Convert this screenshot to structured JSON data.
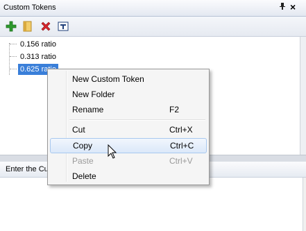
{
  "panel": {
    "title": "Custom Tokens",
    "pin_icon": "pin-icon",
    "close_icon": "close-icon"
  },
  "toolbar": {
    "buttons": [
      {
        "name": "add-button",
        "icon": "green-plus-icon",
        "color": "#2e9a2e"
      },
      {
        "name": "folder-button",
        "icon": "folder-icon",
        "color": "#e0b64a"
      },
      {
        "name": "delete-button",
        "icon": "red-x-icon",
        "color": "#d6262c"
      },
      {
        "name": "text-button",
        "icon": "text-icon",
        "color": "#1f3f7a"
      }
    ]
  },
  "tree": {
    "items": [
      {
        "label": "0.156 ratio",
        "selected": false
      },
      {
        "label": "0.313 ratio",
        "selected": false
      },
      {
        "label": "0.625 ratio",
        "selected": true
      }
    ]
  },
  "bottom_panel": {
    "header": "Enter the Cu"
  },
  "context_menu": {
    "items": [
      {
        "label": "New Custom Token",
        "shortcut": ""
      },
      {
        "label": "New Folder",
        "shortcut": ""
      },
      {
        "label": "Rename",
        "shortcut": "F2"
      },
      {
        "label": "Cut",
        "shortcut": "Ctrl+X"
      },
      {
        "label": "Copy",
        "shortcut": "Ctrl+C",
        "hover": true
      },
      {
        "label": "Paste",
        "shortcut": "Ctrl+V",
        "disabled": true
      },
      {
        "label": "Delete",
        "shortcut": ""
      }
    ]
  },
  "colors": {
    "selection": "#3a7fd9",
    "menu_hover_border": "#a8c8ef"
  }
}
